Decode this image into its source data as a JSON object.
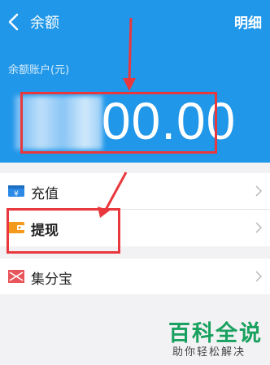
{
  "header": {
    "title": "余额",
    "detail_link": "明细",
    "account_label": "余额账户(元)",
    "balance_visible": "00.00"
  },
  "menu": {
    "group1": [
      {
        "label": "充值",
        "icon": "recharge-icon"
      },
      {
        "label": "提现",
        "icon": "withdraw-icon"
      }
    ],
    "group2": [
      {
        "label": "集分宝",
        "icon": "jifenbao-icon"
      }
    ]
  },
  "watermark": {
    "title": "百科全说",
    "subtitle": "助你轻松解决"
  },
  "colors": {
    "header_bg": "#2197e9",
    "annotation_red": "#e8383d",
    "watermark_green": "#19a15f"
  }
}
